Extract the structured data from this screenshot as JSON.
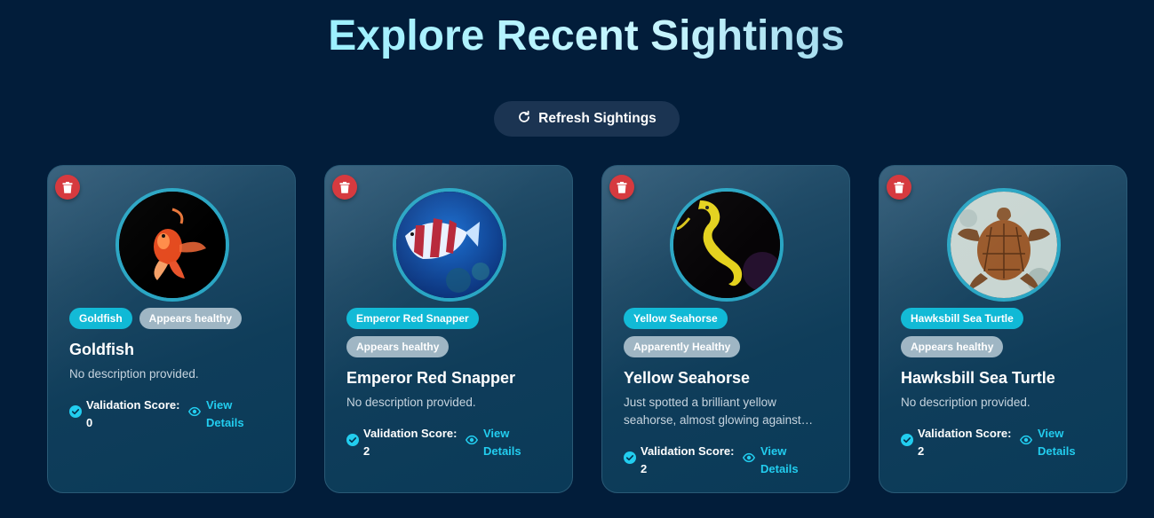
{
  "header": {
    "title": "Explore Recent Sightings"
  },
  "toolbar": {
    "refresh_label": "Refresh Sightings"
  },
  "cards": [
    {
      "species_tag": "Goldfish",
      "health_tags": [
        "Appears healthy"
      ],
      "name": "Goldfish",
      "description": "No description provided.",
      "score_label": "Validation Score:",
      "score": "0",
      "view_label": "View Details",
      "photo_icon": "goldfish-photo"
    },
    {
      "species_tag": "Emperor Red Snapper",
      "health_tags": [
        "Appears healthy"
      ],
      "name": "Emperor Red Snapper",
      "description": "No description provided.",
      "score_label": "Validation Score:",
      "score": "2",
      "view_label": "View Details",
      "photo_icon": "red-snapper-photo"
    },
    {
      "species_tag": "Yellow Seahorse",
      "health_tags": [
        "Apparently Healthy"
      ],
      "name": "Yellow Seahorse",
      "description": "Just spotted a brilliant yellow seahorse, almost glowing against…",
      "score_label": "Validation Score:",
      "score": "2",
      "view_label": "View Details",
      "photo_icon": "seahorse-photo"
    },
    {
      "species_tag": "Hawksbill Sea Turtle",
      "health_tags": [
        "Appears healthy"
      ],
      "name": "Hawksbill Sea Turtle",
      "description": "No description provided.",
      "score_label": "Validation Score:",
      "score": "2",
      "view_label": "View Details",
      "photo_icon": "sea-turtle-photo"
    }
  ],
  "colors": {
    "background": "#021d3a",
    "species_tag": "#10b9d6",
    "health_tag": "#9fb6c4",
    "delete": "#d63a3f",
    "link": "#22cdef"
  }
}
